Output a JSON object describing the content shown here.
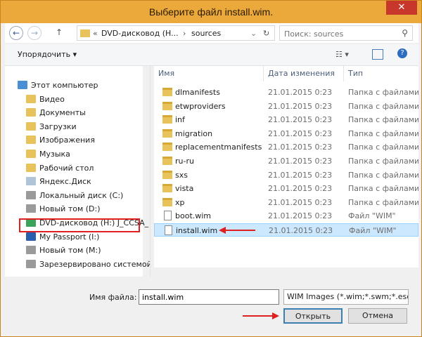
{
  "window": {
    "title": "Выберите файл install.wim."
  },
  "nav": {
    "back_icon": "back-arrow-icon",
    "forward_icon": "forward-arrow-icon",
    "up_icon": "up-arrow-icon",
    "address": {
      "prefix": "«",
      "drive": "DVD-дисковод (H...",
      "sep": "›",
      "folder": "sources"
    },
    "search_placeholder": "Поиск: sources"
  },
  "toolbar": {
    "organize_label": "Упорядочить ▾"
  },
  "sidebar": {
    "items": [
      {
        "label": "Этот компьютер",
        "icon": "computer-icon"
      },
      {
        "label": "Видео",
        "icon": "video-folder-icon"
      },
      {
        "label": "Документы",
        "icon": "documents-folder-icon"
      },
      {
        "label": "Загрузки",
        "icon": "downloads-folder-icon"
      },
      {
        "label": "Изображения",
        "icon": "pictures-folder-icon"
      },
      {
        "label": "Музыка",
        "icon": "music-folder-icon"
      },
      {
        "label": "Рабочий стол",
        "icon": "desktop-folder-icon"
      },
      {
        "label": "Яндекс.Диск",
        "icon": "yandex-disk-icon"
      },
      {
        "label": "Локальный диск (C:)",
        "icon": "drive-icon"
      },
      {
        "label": "Новый том (D:)",
        "icon": "drive-icon"
      },
      {
        "label": "DVD-дисковод (H:) J_CCSA_",
        "icon": "dvd-drive-icon"
      },
      {
        "label": "My Passport (I:)",
        "icon": "usb-drive-icon"
      },
      {
        "label": "Новый том (M:)",
        "icon": "drive-icon"
      },
      {
        "label": "Зарезервировано системой",
        "icon": "drive-icon"
      }
    ]
  },
  "files": {
    "columns": {
      "name": "Имя",
      "date": "Дата изменения",
      "type": "Тип"
    },
    "rows": [
      {
        "name": "dlmanifests",
        "date": "21.01.2015 0:23",
        "type": "Папка с файлами",
        "kind": "folder"
      },
      {
        "name": "etwproviders",
        "date": "21.01.2015 0:23",
        "type": "Папка с файлами",
        "kind": "folder"
      },
      {
        "name": "inf",
        "date": "21.01.2015 0:23",
        "type": "Папка с файлами",
        "kind": "folder"
      },
      {
        "name": "migration",
        "date": "21.01.2015 0:23",
        "type": "Папка с файлами",
        "kind": "folder"
      },
      {
        "name": "replacementmanifests",
        "date": "21.01.2015 0:23",
        "type": "Папка с файлами",
        "kind": "folder"
      },
      {
        "name": "ru-ru",
        "date": "21.01.2015 0:23",
        "type": "Папка с файлами",
        "kind": "folder"
      },
      {
        "name": "sxs",
        "date": "21.01.2015 0:23",
        "type": "Папка с файлами",
        "kind": "folder"
      },
      {
        "name": "vista",
        "date": "21.01.2015 0:23",
        "type": "Папка с файлами",
        "kind": "folder"
      },
      {
        "name": "xp",
        "date": "21.01.2015 0:23",
        "type": "Папка с файлами",
        "kind": "folder"
      },
      {
        "name": "boot.wim",
        "date": "21.01.2015 0:23",
        "type": "Файл \"WIM\"",
        "kind": "file"
      },
      {
        "name": "install.wim",
        "date": "21.01.2015 0:23",
        "type": "Файл \"WIM\"",
        "kind": "file"
      }
    ]
  },
  "bottom": {
    "filename_label": "Имя файла:",
    "filename_value": "install.wim",
    "filetype_value": "WIM Images (*.wim;*.swm;*.esd)",
    "open_label": "Открыть",
    "cancel_label": "Отмена"
  },
  "colors": {
    "title_bar": "#eba93c",
    "close": "#c7372c",
    "selection": "#cce8ff",
    "annotation": "#e02020"
  }
}
